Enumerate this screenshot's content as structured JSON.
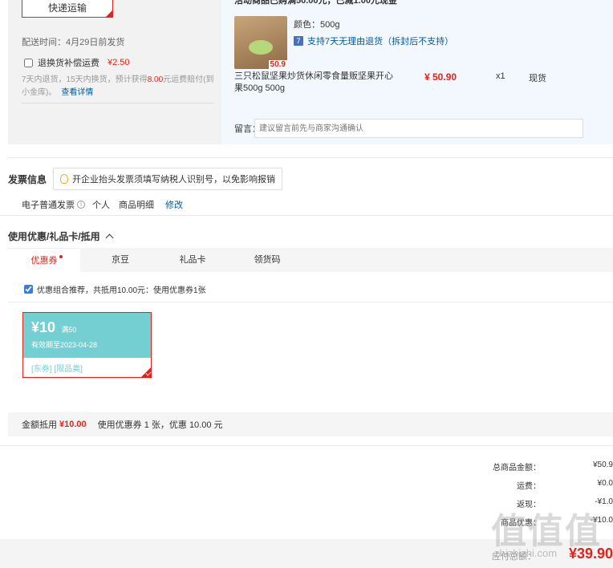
{
  "shipping": {
    "method_label": "快递运输",
    "delivery_time": "配送时间：4月29日前发货",
    "insurance_label": "退换货补偿运费",
    "insurance_price": "¥2.50",
    "insurance_desc_pre": "7天内退货，15天内换货，预计获得",
    "insurance_desc_amount": "8.00",
    "insurance_desc_post": "元运费赔付(到小金库)。",
    "insurance_link": "查看详情"
  },
  "order": {
    "promo_tip": "活动商品已购满50.00元，已减1.00元现金",
    "image_tag": "50.9",
    "attr_color": "颜色：500g",
    "return_icon": "7",
    "return_policy": "支持7天无理由退货（拆封后不支持）",
    "product_name": "三只松鼠坚果炒货休闲零食量贩坚果开心果500g 500g",
    "price": "¥ 50.90",
    "quantity": "x1",
    "stock": "现货",
    "message_label": "留言：",
    "message_placeholder": "建议留言前先与商家沟通确认"
  },
  "invoice": {
    "title": "发票信息",
    "tip": "开企业抬头发票须填写纳税人识别号，以免影响报销",
    "type": "电子普通发票",
    "help": "i",
    "person": "个人",
    "detail": "商品明细",
    "edit": "修改"
  },
  "coupons": {
    "title": "使用优惠/礼品卡/抵用",
    "tabs": [
      {
        "label": "优惠券"
      },
      {
        "label": "京豆"
      },
      {
        "label": "礼品卡"
      },
      {
        "label": "领货码"
      }
    ],
    "combo_label": "优惠组合推荐，共抵用10.00元：使用优惠券1张",
    "combo_checked": true,
    "coupon": {
      "amount": "¥10",
      "condition": "满50",
      "validity": "有效期至2023-04-28",
      "tags": "[东券] [限品类]",
      "color": "#74cfd2"
    },
    "summary_label": "金额抵用",
    "summary_amount": "¥10.00",
    "summary_desc": "使用优惠券 1 张，优惠 10.00 元"
  },
  "totals": {
    "rows": [
      {
        "label": "总商品金额：",
        "value": "¥50.9"
      },
      {
        "label": "运费：",
        "value": "¥0.0"
      },
      {
        "label": "返现：",
        "value": "-¥1.0"
      },
      {
        "label": "商品优惠：",
        "value": "-¥10.0"
      }
    ],
    "payable_label": "应付总额：",
    "payable_amount": "¥39.90"
  },
  "watermark": {
    "main": "值值值",
    "sub": "zhizhizhi.com"
  },
  "colors": {
    "accent": "#e2231a",
    "link": "#005aa0",
    "coupon": "#74cfd2"
  }
}
